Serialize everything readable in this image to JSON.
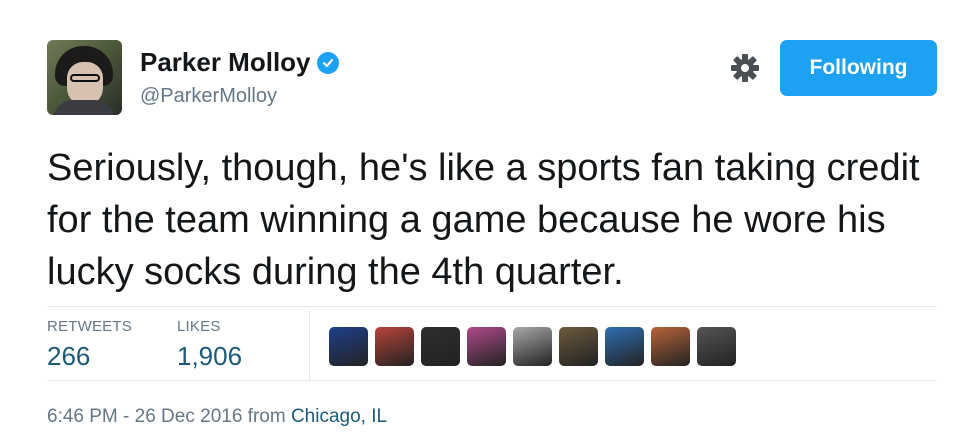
{
  "author": {
    "name": "Parker Molloy",
    "handle": "@ParkerMolloy",
    "verified": true,
    "verified_icon": "verified-badge-icon"
  },
  "actions": {
    "settings_icon": "gear-icon",
    "follow_label": "Following",
    "accent_color": "#1da1f2"
  },
  "tweet": {
    "text": "Seriously, though, he's like a sports fan taking credit for the team winning a game because he wore his lucky socks during the 4th quarter."
  },
  "stats": {
    "retweets_label": "RETWEETS",
    "retweets_value": "266",
    "likes_label": "LIKES",
    "likes_value": "1,906"
  },
  "likers": [
    {
      "name": "liker-avatar-1",
      "color": "#1f3f8a"
    },
    {
      "name": "liker-avatar-2",
      "color": "#b8443a"
    },
    {
      "name": "liker-avatar-3",
      "color": "#2e2e2e"
    },
    {
      "name": "liker-avatar-4",
      "color": "#b04a8a"
    },
    {
      "name": "liker-avatar-5",
      "color": "#a8a8a8"
    },
    {
      "name": "liker-avatar-6",
      "color": "#6b5a3e"
    },
    {
      "name": "liker-avatar-7",
      "color": "#2e6fb5"
    },
    {
      "name": "liker-avatar-8",
      "color": "#b8643a"
    },
    {
      "name": "liker-avatar-9",
      "color": "#555555"
    }
  ],
  "footer": {
    "timestamp": "6:46 PM - 26 Dec 2016 from ",
    "location": "Chicago, IL"
  }
}
